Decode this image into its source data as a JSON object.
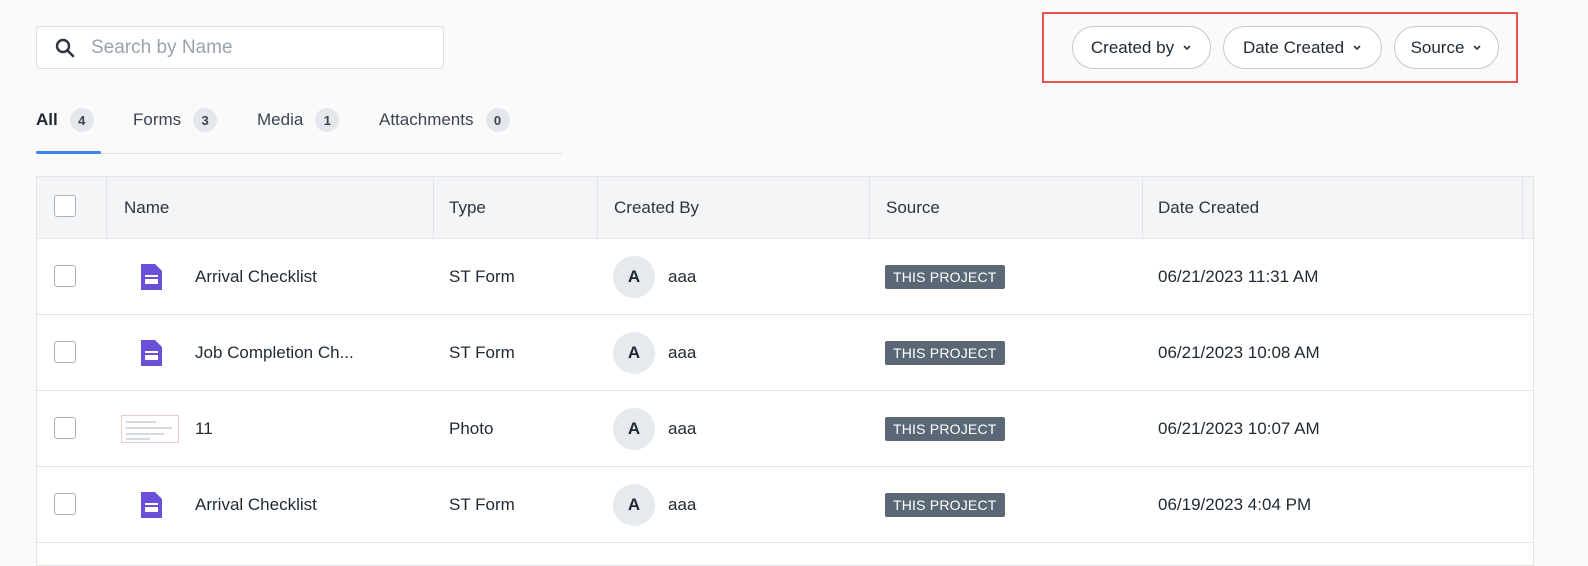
{
  "search": {
    "placeholder": "Search by Name",
    "value": ""
  },
  "filters": [
    {
      "label": "Created by"
    },
    {
      "label": "Date Created"
    },
    {
      "label": "Source"
    }
  ],
  "tabs": [
    {
      "label": "All",
      "count": "4",
      "active": true
    },
    {
      "label": "Forms",
      "count": "3"
    },
    {
      "label": "Media",
      "count": "1"
    },
    {
      "label": "Attachments",
      "count": "0"
    }
  ],
  "table": {
    "columns": [
      "Name",
      "Type",
      "Created By",
      "Source",
      "Date Created"
    ],
    "rows": [
      {
        "icon": "form-icon",
        "name": "Arrival Checklist",
        "type": "ST Form",
        "avatar": "A",
        "created_by": "aaa",
        "source": "THIS PROJECT",
        "date": "06/21/2023 11:31 AM"
      },
      {
        "icon": "form-icon",
        "name": "Job Completion Ch...",
        "type": "ST Form",
        "avatar": "A",
        "created_by": "aaa",
        "source": "THIS PROJECT",
        "date": "06/21/2023 10:08 AM"
      },
      {
        "icon": "photo-thumbnail",
        "name": "11",
        "type": "Photo",
        "avatar": "A",
        "created_by": "aaa",
        "source": "THIS PROJECT",
        "date": "06/21/2023 10:07 AM"
      },
      {
        "icon": "form-icon",
        "name": "Arrival Checklist",
        "type": "ST Form",
        "avatar": "A",
        "created_by": "aaa",
        "source": "THIS PROJECT",
        "date": "06/19/2023 4:04 PM"
      }
    ]
  },
  "colors": {
    "accent": "#3b82f6",
    "highlight": "#e8534f",
    "form_icon": "#6b4fd8",
    "badge": "#5a6775"
  }
}
